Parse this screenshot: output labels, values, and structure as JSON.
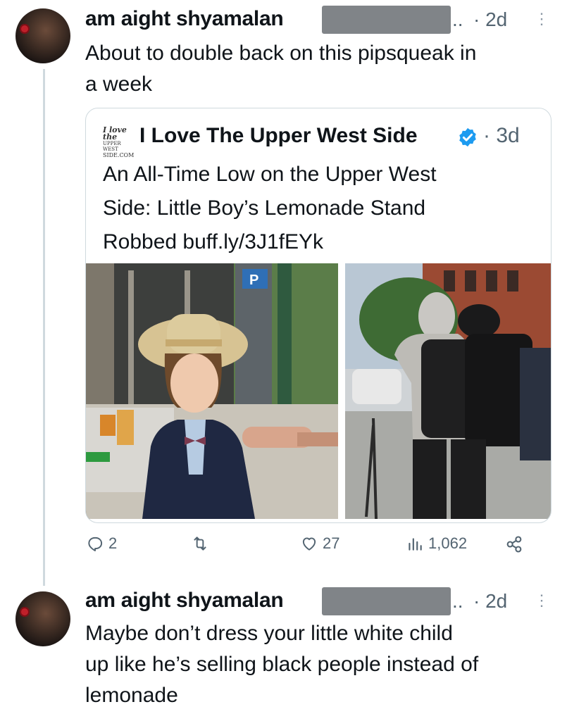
{
  "tweets": [
    {
      "author": "am aight shyamalan",
      "handle_suffix": "..",
      "time": "· 2d",
      "text_lines": [
        "About to double back on this pipsqueak in",
        "a week"
      ]
    },
    {
      "author": "am aight shyamalan",
      "handle_suffix": "..",
      "time": "· 2d",
      "text_lines": [
        "Maybe don’t dress your little white child",
        "up like he’s selling black people instead of",
        "lemonade"
      ]
    }
  ],
  "quote": {
    "logo_lines": [
      "I love the",
      "UPPER WEST",
      "SIDE.COM"
    ],
    "author": "I Love The Upper West Side",
    "time": "· 3d",
    "text_lines": [
      "An All-Time Low on the Upper West",
      "Side: Little Boy’s Lemonade Stand",
      "Robbed buff.ly/3J1fEYk"
    ],
    "photos": [
      {
        "description_icon": "photo-boy-lemonade-stand"
      },
      {
        "description_icon": "photo-street-backpack"
      }
    ]
  },
  "actions": {
    "replies": "2",
    "retweets": "",
    "likes": "27",
    "views": "1,062"
  },
  "more_glyph": "⋮",
  "colors": {
    "text": "#0f1419",
    "muted": "#536471",
    "verified": "#1d9bf0",
    "border": "#cfd9de",
    "redaction": "#808488"
  }
}
